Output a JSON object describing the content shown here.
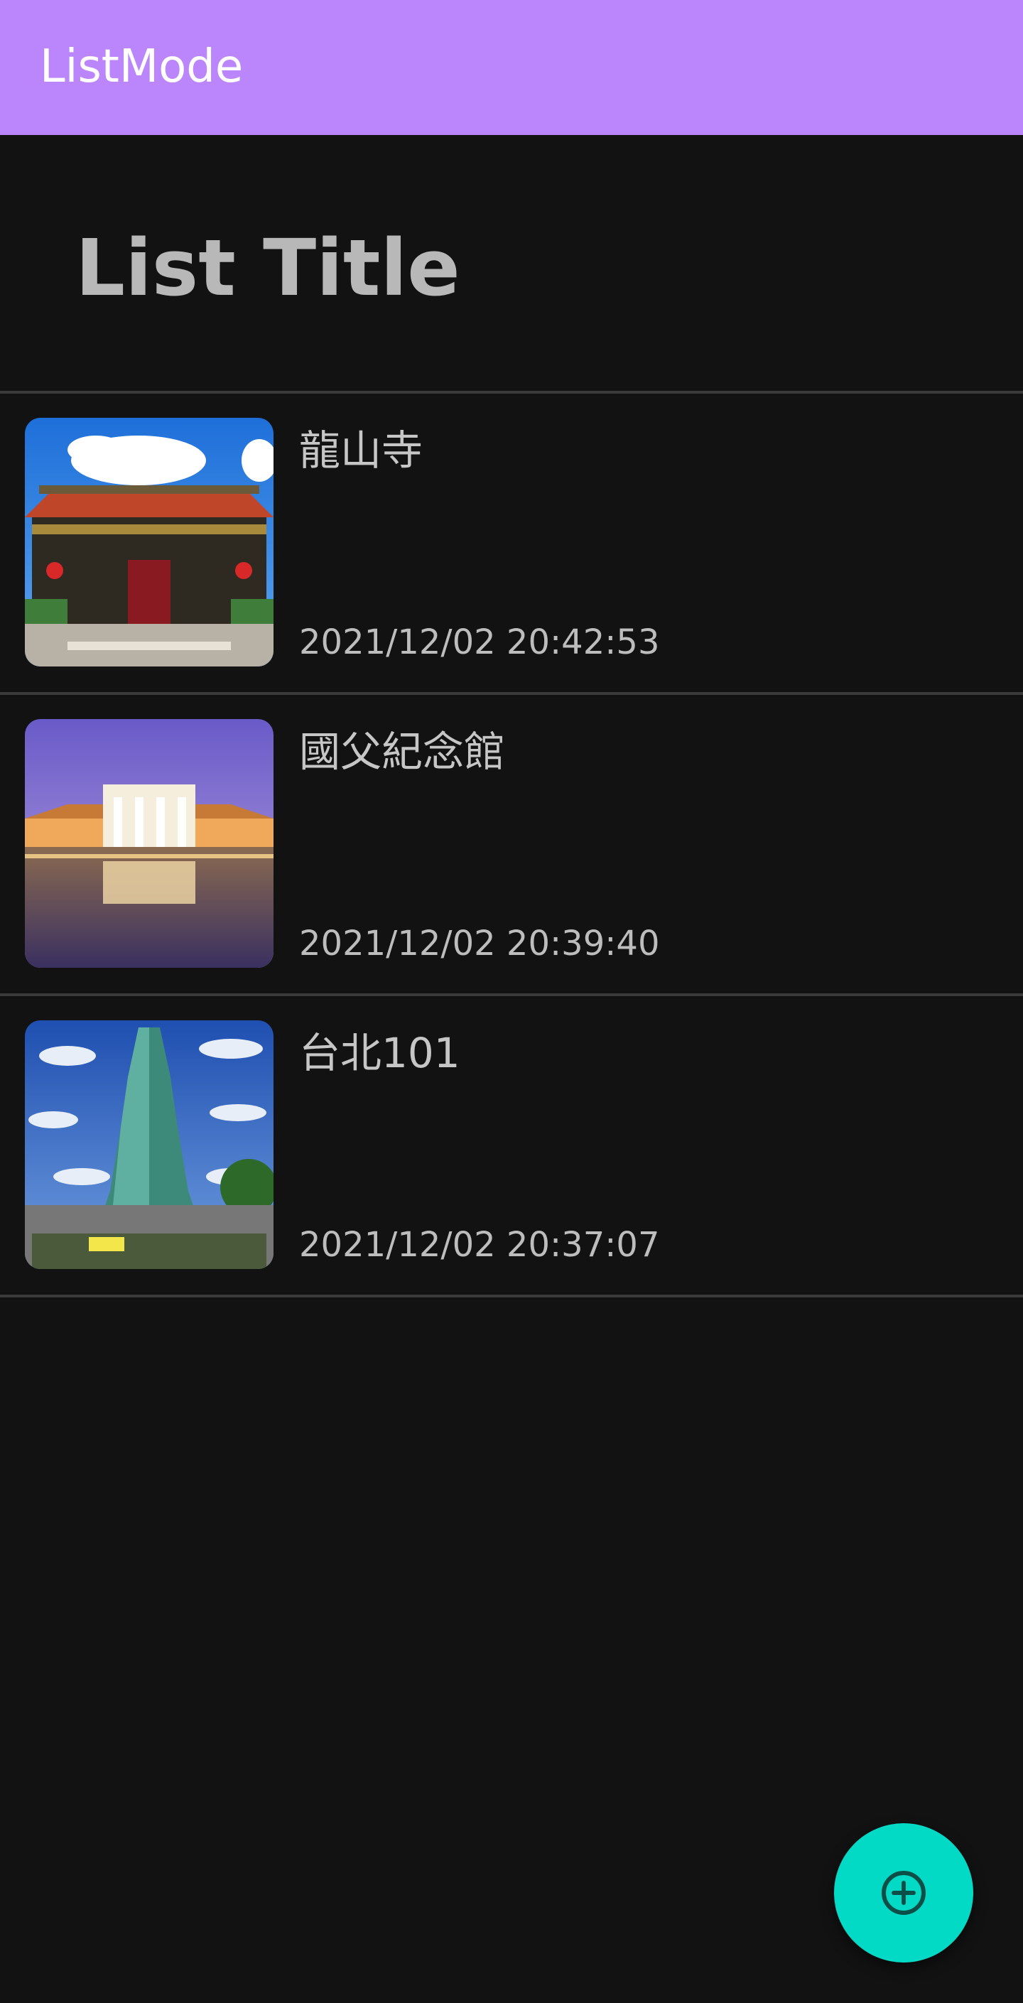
{
  "app_bar": {
    "title": "ListMode",
    "color": "#bb86fc"
  },
  "list_title": "List Title",
  "items": [
    {
      "title": "龍山寺",
      "timestamp": "2021/12/02 20:42:53"
    },
    {
      "title": "國父紀念館",
      "timestamp": "2021/12/02 20:39:40"
    },
    {
      "title": "台北101",
      "timestamp": "2021/12/02 20:37:07"
    }
  ],
  "fab": {
    "icon": "add-circle-icon",
    "color": "#03dac5"
  },
  "colors": {
    "background": "#121212",
    "divider": "#3a3a3a",
    "text": "#c6c6c6"
  }
}
